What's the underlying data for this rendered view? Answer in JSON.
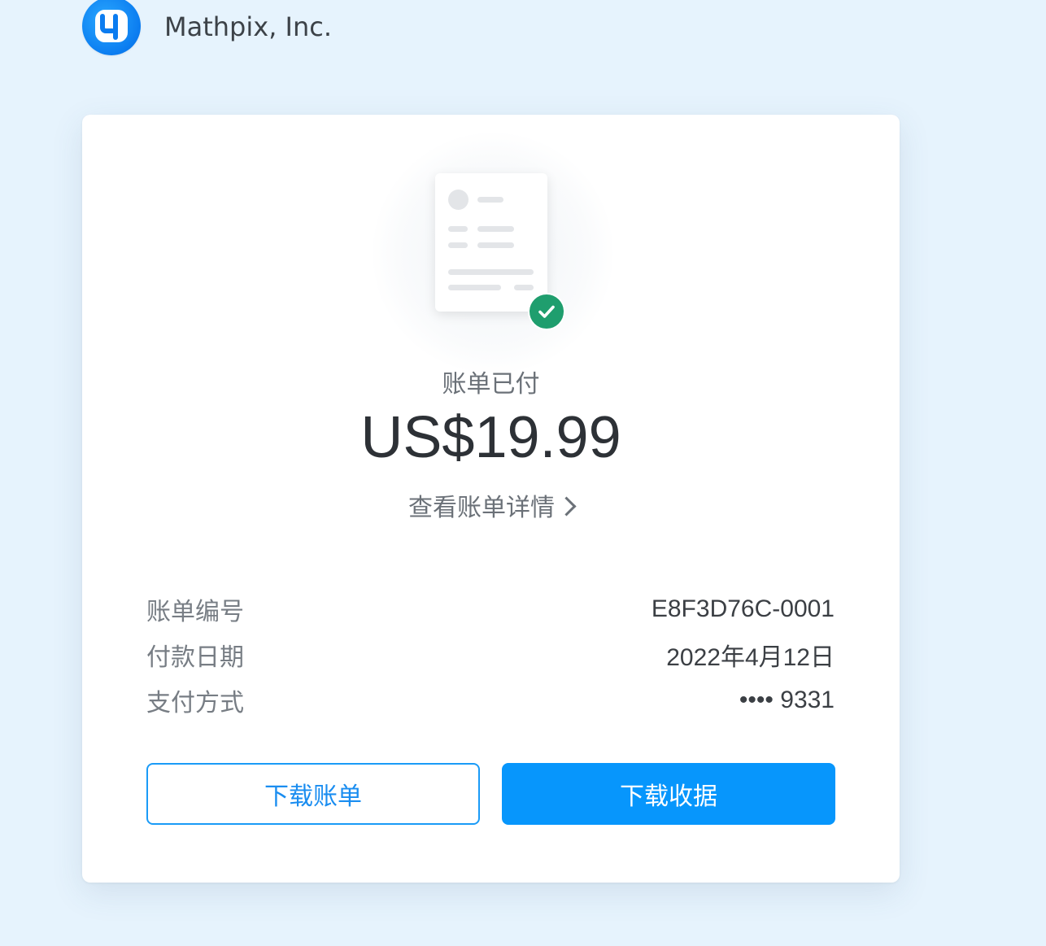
{
  "header": {
    "company_name": "Mathpix, Inc."
  },
  "receipt": {
    "status": "账单已付",
    "amount": "US$19.99",
    "details_link": "查看账单详情",
    "rows": [
      {
        "label": "账单编号",
        "value": "E8F3D76C-0001"
      },
      {
        "label": "付款日期",
        "value": "2022年4月12日"
      },
      {
        "label": "支付方式",
        "value": "•••• 9331"
      }
    ]
  },
  "actions": {
    "download_invoice": "下载账单",
    "download_receipt": "下载收据"
  },
  "colors": {
    "background": "#e6f3fd",
    "brand_blue": "#0796fc",
    "success_green": "#1f9e6e"
  },
  "icons": {
    "logo": "mathpix-logo-icon",
    "document": "invoice-document-icon",
    "check": "check-circle-icon",
    "chevron": "chevron-right-icon"
  }
}
